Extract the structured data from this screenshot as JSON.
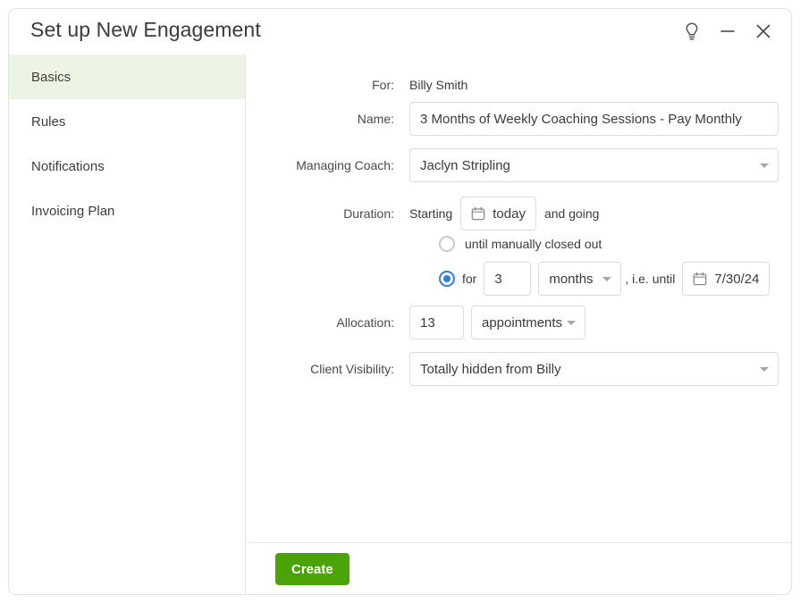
{
  "window": {
    "title": "Set up New Engagement",
    "controls": [
      {
        "name": "help-idea-icon",
        "label": "Tips"
      },
      {
        "name": "minimize-icon",
        "label": "Minimize"
      },
      {
        "name": "close-icon",
        "label": "Close"
      }
    ]
  },
  "sidebar": {
    "items": [
      {
        "label": "Basics",
        "active": true
      },
      {
        "label": "Rules",
        "active": false
      },
      {
        "label": "Notifications",
        "active": false
      },
      {
        "label": "Invoicing Plan",
        "active": false
      }
    ]
  },
  "form": {
    "for": {
      "label": "For:",
      "value": "Billy Smith"
    },
    "name": {
      "label": "Name:",
      "value": "3 Months of Weekly Coaching Sessions - Pay Monthly"
    },
    "managing_coach": {
      "label": "Managing Coach:",
      "value": "Jaclyn Stripling"
    },
    "duration": {
      "label": "Duration:",
      "starting_text": "Starting",
      "start_date": "today",
      "and_going_text": "and going",
      "option_manual": {
        "label": "until manually closed out",
        "selected": false
      },
      "option_fixed": {
        "selected": true,
        "for_text": "for",
        "amount": "3",
        "unit": "months",
        "until_text": ", i.e. until",
        "end_date": "7/30/24"
      }
    },
    "allocation": {
      "label": "Allocation:",
      "amount": "13",
      "unit": "appointments"
    },
    "client_visibility": {
      "label": "Client Visibility:",
      "value": "Totally hidden from Billy"
    }
  },
  "footer": {
    "create_label": "Create"
  },
  "colors": {
    "accent_green": "#4aa307",
    "active_nav_bg": "#edf4e4",
    "radio_blue": "#2f7fe0"
  }
}
